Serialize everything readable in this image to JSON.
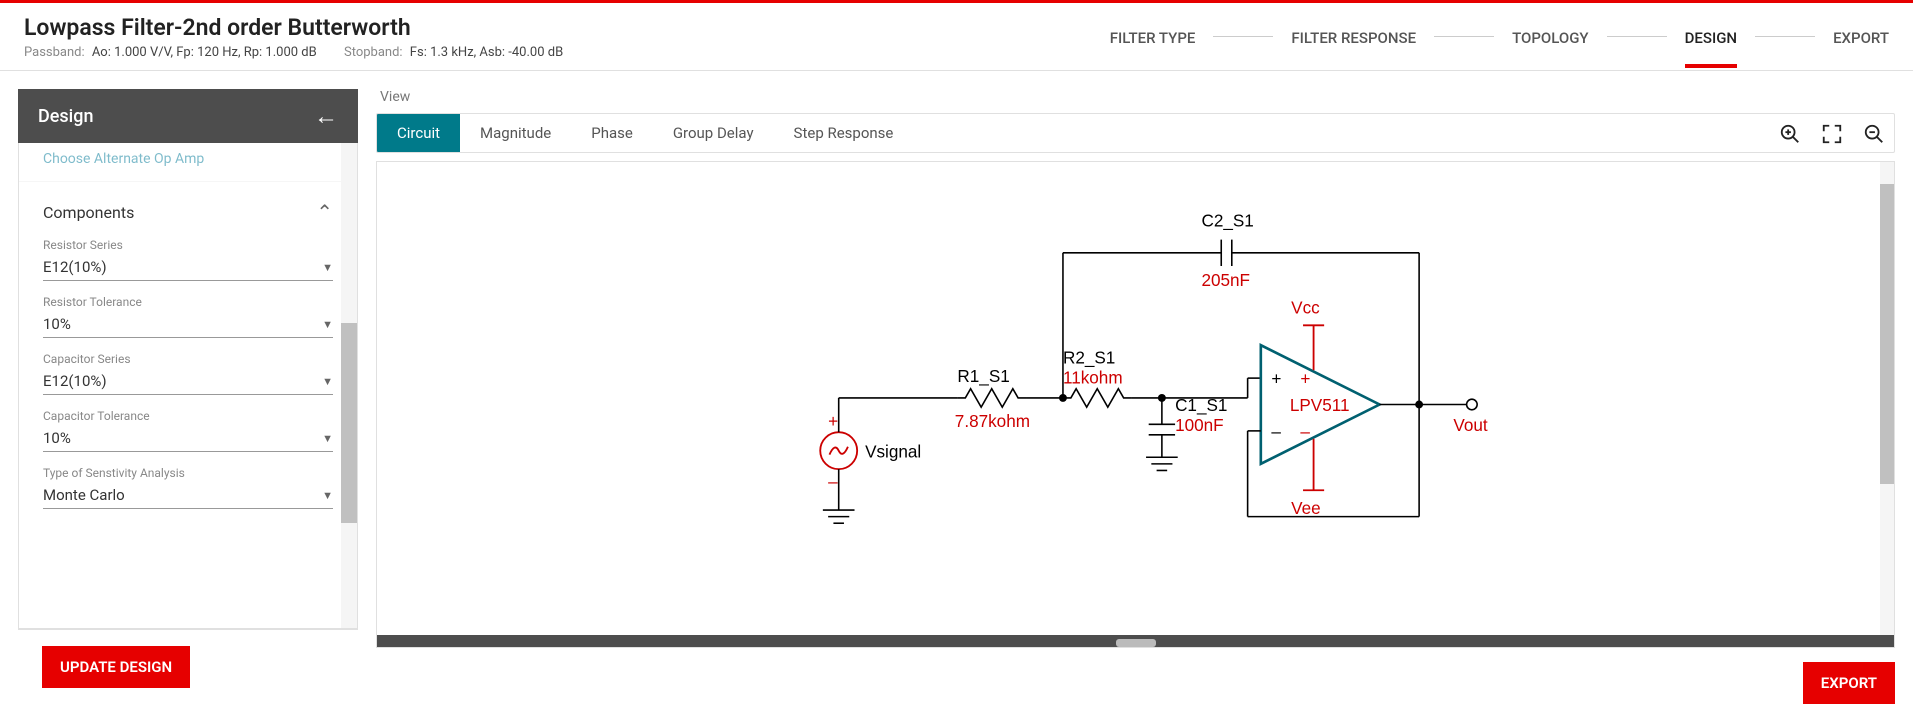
{
  "header": {
    "title": "Lowpass Filter-2nd order Butterworth",
    "passband_label": "Passband:",
    "passband_value": "Ao: 1.000 V/V, Fp: 120 Hz, Rp: 1.000 dB",
    "stopband_label": "Stopband:",
    "stopband_value": "Fs: 1.3 kHz, Asb: -40.00 dB"
  },
  "steps": [
    "FILTER TYPE",
    "FILTER RESPONSE",
    "TOPOLOGY",
    "DESIGN",
    "EXPORT"
  ],
  "active_step": 3,
  "sidebar": {
    "title": "Design",
    "alt_link": "Choose Alternate Op Amp",
    "section": "Components",
    "fields": [
      {
        "label": "Resistor Series",
        "value": "E12(10%)"
      },
      {
        "label": "Resistor Tolerance",
        "value": "10%"
      },
      {
        "label": "Capacitor Series",
        "value": "E12(10%)"
      },
      {
        "label": "Capacitor Tolerance",
        "value": "10%"
      },
      {
        "label": "Type of Senstivity Analysis",
        "value": "Monte Carlo"
      }
    ],
    "update_btn": "UPDATE DESIGN"
  },
  "view": {
    "label": "View",
    "tabs": [
      "Circuit",
      "Magnitude",
      "Phase",
      "Group Delay",
      "Step Response"
    ],
    "active_tab": 0
  },
  "circuit": {
    "vsignal": "Vsignal",
    "r1_name": "R1_S1",
    "r1_val": "7.87kohm",
    "r2_name": "R2_S1",
    "r2_val": "11kohm",
    "c1_name": "C1_S1",
    "c1_val": "100nF",
    "c2_name": "C2_S1",
    "c2_val": "205nF",
    "vcc": "Vcc",
    "vee": "Vee",
    "opamp": "LPV511",
    "vout": "Vout",
    "plus": "+",
    "minus": "–"
  },
  "export_btn": "EXPORT"
}
